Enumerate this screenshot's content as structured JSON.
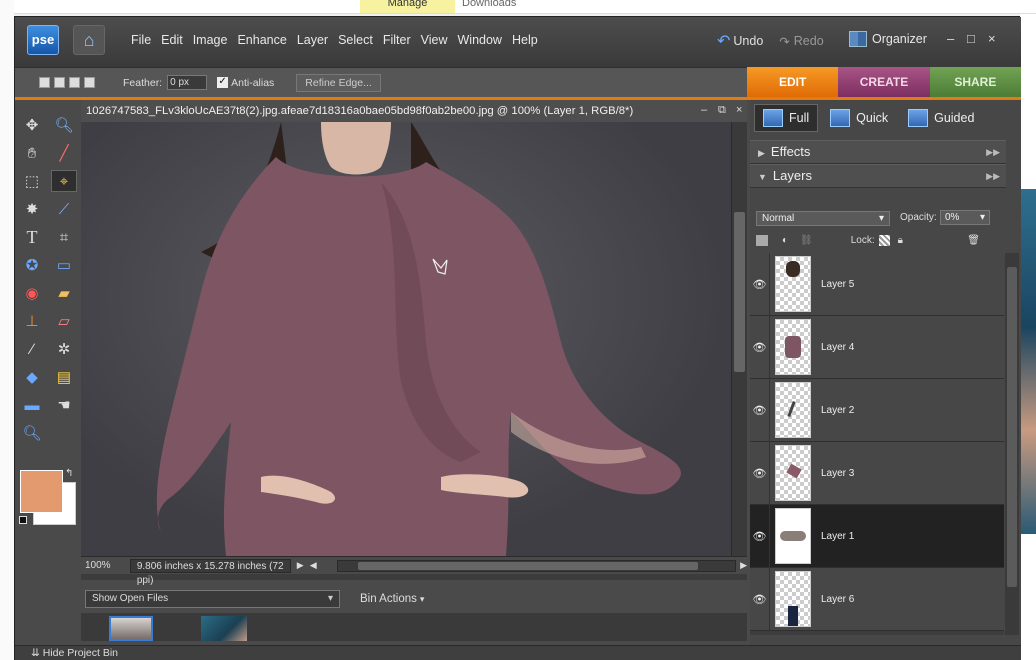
{
  "background": {
    "tab1": "Manage",
    "tab2": "Downloads"
  },
  "app": {
    "logo": "pse",
    "menu": [
      "File",
      "Edit",
      "Image",
      "Enhance",
      "Layer",
      "Select",
      "Filter",
      "View",
      "Window",
      "Help"
    ],
    "undo": "Undo",
    "redo": "Redo",
    "organizer": "Organizer",
    "window_controls": [
      "–",
      "□",
      "×"
    ]
  },
  "options": {
    "feather_label": "Feather:",
    "feather_value": "0 px",
    "antialias_label": "Anti-alias",
    "antialias_checked": true,
    "refine_edge": "Refine Edge..."
  },
  "mode_tabs": [
    "EDIT",
    "CREATE",
    "SHARE"
  ],
  "document": {
    "title": "1026747583_FLv3kloUcAE37t8(2).jpg.afeae7d18316a0bae05bd98f0ab2be00.jpg @ 100% (Layer 1, RGB/8*)",
    "zoom": "100%",
    "dimensions": "9.806 inches x 15.278 inches (72 ppi)"
  },
  "colors": {
    "foreground": "#e29a6e",
    "background": "#ffffff",
    "accent_edit": "#e47a12"
  },
  "tools": [
    "move-icon",
    "zoom-icon",
    "hand-icon",
    "eyedropper-icon",
    "marquee-icon",
    "lasso-icon",
    "magic-wand-icon",
    "quick-selection-icon",
    "type-icon",
    "crop-icon",
    "shape-icon",
    "cookie-cutter-icon",
    "red-eye-icon",
    "healing-brush-icon",
    "stamp-icon",
    "eraser-icon",
    "brush-icon",
    "smart-brush-icon",
    "paint-bucket-icon",
    "gradient-icon",
    "rectangle-icon",
    "smudge-icon",
    "blur-icon"
  ],
  "panel": {
    "views": [
      "Full",
      "Quick",
      "Guided"
    ],
    "effects": "Effects",
    "layers": "Layers",
    "blend_mode": "Normal",
    "opacity_label": "Opacity:",
    "opacity_value": "0%",
    "lock_label": "Lock:",
    "layer_list": [
      {
        "name": "Layer 5",
        "selected": false
      },
      {
        "name": "Layer 4",
        "selected": false
      },
      {
        "name": "Layer 2",
        "selected": false
      },
      {
        "name": "Layer 3",
        "selected": false
      },
      {
        "name": "Layer 1",
        "selected": true
      },
      {
        "name": "Layer 6",
        "selected": false
      }
    ]
  },
  "bin": {
    "show_select": "Show Open Files",
    "actions": "Bin Actions",
    "hide": "Hide Project Bin"
  }
}
